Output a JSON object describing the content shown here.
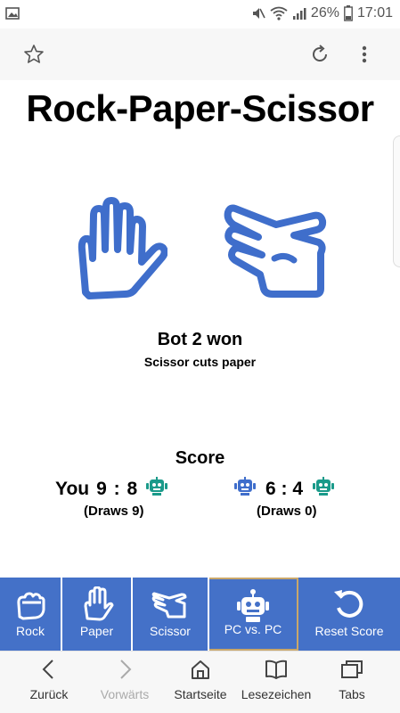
{
  "status_bar": {
    "battery_text": "26%",
    "time": "17:01"
  },
  "browser": {
    "star_icon": "star-outline-icon",
    "reload_icon": "reload-icon",
    "menu_icon": "more-vertical-icon"
  },
  "game": {
    "title": "Rock-Paper-Scissor",
    "left_hand": "paper-hand-icon",
    "right_hand": "scissor-hand-icon",
    "result_title": "Bot 2 won",
    "result_subtitle": "Scissor cuts paper"
  },
  "score": {
    "heading": "Score",
    "left_player": "You",
    "left_score": "9 : 8",
    "left_draws": "(Draws 9)",
    "right_score": "6 : 4",
    "right_draws": "(Draws 0)"
  },
  "actions": [
    {
      "label": "Rock",
      "icon": "rock-fist-icon"
    },
    {
      "label": "Paper",
      "icon": "paper-hand-icon"
    },
    {
      "label": "Scissor",
      "icon": "scissor-hand-icon"
    },
    {
      "label": "PC vs. PC",
      "icon": "robot-icon"
    },
    {
      "label": "Reset Score",
      "icon": "reset-icon"
    }
  ],
  "nav": [
    {
      "label": "Zurück",
      "icon": "back-icon"
    },
    {
      "label": "Vorwärts",
      "icon": "forward-icon"
    },
    {
      "label": "Startseite",
      "icon": "home-icon"
    },
    {
      "label": "Lesezeichen",
      "icon": "bookmarks-icon"
    },
    {
      "label": "Tabs",
      "icon": "tabs-icon"
    }
  ],
  "colors": {
    "accent": "#4471c8",
    "hand_stroke": "#3f6ecb",
    "robot_teal": "#1a9a8a",
    "robot_blue": "#3f6ecb"
  }
}
